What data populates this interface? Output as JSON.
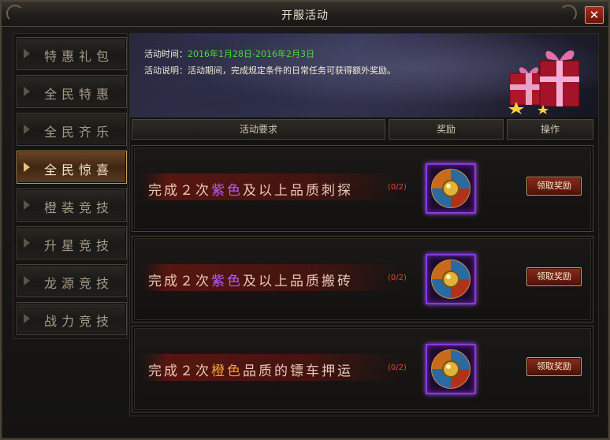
{
  "window": {
    "title": "开服活动"
  },
  "sidebar": {
    "items": [
      {
        "label": "特惠礼包",
        "active": false
      },
      {
        "label": "全民特惠",
        "active": false
      },
      {
        "label": "全民齐乐",
        "active": false
      },
      {
        "label": "全民惊喜",
        "active": true
      },
      {
        "label": "橙装竞技",
        "active": false
      },
      {
        "label": "升星竞技",
        "active": false
      },
      {
        "label": "龙源竞技",
        "active": false
      },
      {
        "label": "战力竞技",
        "active": false
      }
    ]
  },
  "banner": {
    "time_label": "活动时间：",
    "time_value": "2016年1月28日-2016年2月3日",
    "desc_label": "活动说明：",
    "desc_value": "活动期间，完成规定条件的日常任务可获得额外奖励。"
  },
  "table": {
    "headers": {
      "requirement": "活动要求",
      "reward": "奖励",
      "action": "操作"
    }
  },
  "tasks": [
    {
      "pre": "完成２次",
      "highlight": "紫色",
      "highlight_color": "#b55cff",
      "post": "及以上品质刺探",
      "progress": "(0/2)",
      "claim_label": "领取奖励"
    },
    {
      "pre": "完成２次",
      "highlight": "紫色",
      "highlight_color": "#b55cff",
      "post": "及以上品质搬砖",
      "progress": "(0/2)",
      "claim_label": "领取奖励"
    },
    {
      "pre": "完成２次",
      "highlight": "橙色",
      "highlight_color": "#f0a038",
      "post": "品质的镖车押运",
      "progress": "(0/2)",
      "claim_label": "领取奖励"
    }
  ],
  "icons": {
    "close": "close-icon",
    "gift": "gift-box-icon",
    "reward": "shield-medal-icon"
  },
  "colors": {
    "active_tab": "#c79b5c",
    "time_value": "#4cdc3c",
    "progress": "#e04a2a",
    "purple_frame": "#8a3ad8"
  }
}
